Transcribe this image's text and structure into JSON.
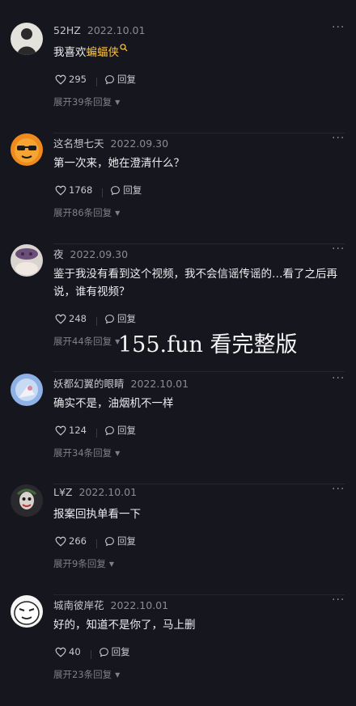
{
  "comments": [
    {
      "username": "52HZ",
      "date": "2022.10.01",
      "text_before": "我喜欢",
      "text_highlight": "蝙蝠侠",
      "likes": "295",
      "reply_label": "回复",
      "expand_label": "展开39条回复",
      "avatar_icon": "person-silhouette-avatar"
    },
    {
      "username": "这名想七天",
      "date": "2022.09.30",
      "text": "第一次来，她在澄清什么？",
      "likes": "1768",
      "reply_label": "回复",
      "expand_label": "展开86条回复",
      "avatar_icon": "sunglasses-emoji-avatar"
    },
    {
      "username": "夜",
      "date": "2022.09.30",
      "text": "鉴于我没有看到这个视频，我不会信谣传谣的…看了之后再说，谁有视频？",
      "likes": "248",
      "reply_label": "回复",
      "expand_label": "展开44条回复",
      "avatar_icon": "cat-avatar"
    },
    {
      "username": "妖都幻翼的眼睛",
      "date": "2022.10.01",
      "text": "确实不是，油烟机不一样",
      "likes": "124",
      "reply_label": "回复",
      "expand_label": "展开34条回复",
      "avatar_icon": "anime-avatar"
    },
    {
      "username": "L¥Z",
      "date": "2022.10.01",
      "text": "报案回执单看一下",
      "likes": "266",
      "reply_label": "回复",
      "expand_label": "展开9条回复",
      "avatar_icon": "joker-avatar"
    },
    {
      "username": "城南彼岸花",
      "date": "2022.10.01",
      "text": "好的，知道不是你了，马上删",
      "likes": "40",
      "reply_label": "回复",
      "expand_label": "展开23条回复",
      "avatar_icon": "meme-face-avatar"
    }
  ],
  "watermark": "155.fun 看完整版",
  "colors": {
    "background": "#16161e",
    "highlight": "#f5c24a"
  }
}
